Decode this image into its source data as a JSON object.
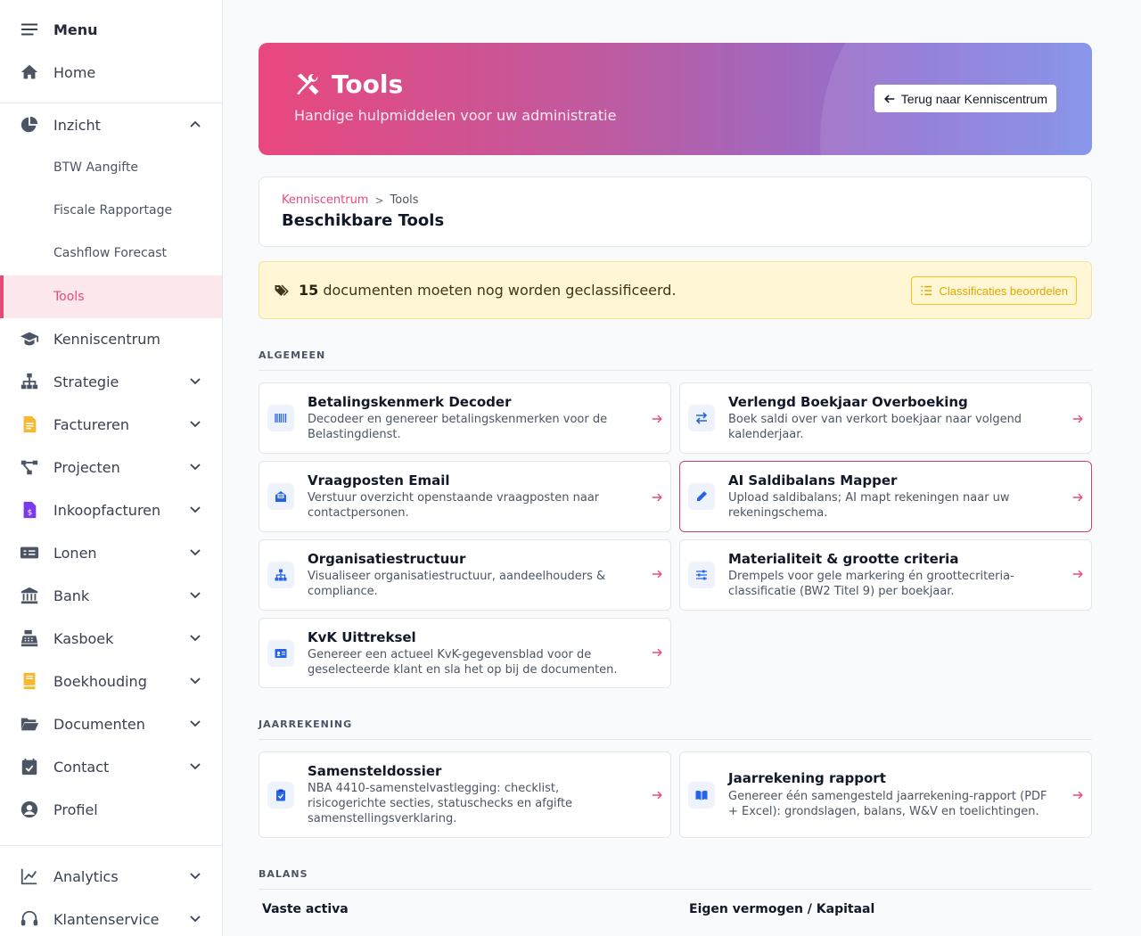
{
  "sidebar": {
    "menu_label": "Menu",
    "home_label": "Home",
    "inzicht": {
      "label": "Inzicht",
      "children": [
        "BTW Aangifte",
        "Fiscale Rapportage",
        "Cashflow Forecast",
        "Tools"
      ]
    },
    "items": [
      {
        "label": "Kenniscentrum",
        "icon": "graduation-cap-icon"
      },
      {
        "label": "Strategie",
        "icon": "sitemap-icon"
      },
      {
        "label": "Factureren",
        "icon": "file-invoice-icon"
      },
      {
        "label": "Projecten",
        "icon": "project-diagram-icon"
      },
      {
        "label": "Inkoopfacturen",
        "icon": "file-dollar-icon"
      },
      {
        "label": "Lonen",
        "icon": "money-check-icon"
      },
      {
        "label": "Bank",
        "icon": "bank-icon"
      },
      {
        "label": "Kasboek",
        "icon": "cash-register-icon"
      },
      {
        "label": "Boekhouding",
        "icon": "book-icon"
      },
      {
        "label": "Documenten",
        "icon": "folder-open-icon"
      },
      {
        "label": "Contact",
        "icon": "calendar-check-icon"
      },
      {
        "label": "Profiel",
        "icon": "user-circle-icon"
      }
    ],
    "bottom_items": [
      {
        "label": "Analytics",
        "icon": "chart-line-icon"
      },
      {
        "label": "Klantenservice",
        "icon": "headset-icon"
      }
    ]
  },
  "hero": {
    "title": "Tools",
    "subtitle": "Handige hulpmiddelen voor uw administratie",
    "back_button": "Terug naar Kenniscentrum"
  },
  "breadcrumb": {
    "link": "Kenniscentrum",
    "separator": ">",
    "current": "Tools",
    "page_title": "Beschikbare Tools"
  },
  "alert": {
    "count": "15",
    "text": " documenten moeten nog worden geclassificeerd.",
    "button": "Classificaties beoordelen"
  },
  "sections": {
    "algemeen": "ALGEMEEN",
    "jaarrekening": "JAARREKENING",
    "balans": "BALANS"
  },
  "tools_algemeen": [
    {
      "title": "Betalingskenmerk Decoder",
      "desc": "Decodeer en genereer betalingskenmerken voor de Belastingdienst.",
      "icon": "barcode-icon"
    },
    {
      "title": "Verlengd Boekjaar Overboeking",
      "desc": "Boek saldi over van verkort boekjaar naar volgend kalenderjaar.",
      "icon": "exchange-icon"
    },
    {
      "title": "Vraagposten Email",
      "desc": "Verstuur overzicht openstaande vraagposten naar contactpersonen.",
      "icon": "envelope-open-icon"
    },
    {
      "title": "AI Saldibalans Mapper",
      "desc": "Upload saldibalans; AI mapt rekeningen naar uw rekeningschema.",
      "icon": "pen-icon"
    },
    {
      "title": "Organisatiestructuur",
      "desc": "Visualiseer organisatiestructuur, aandeelhouders & compliance.",
      "icon": "sitemap-icon"
    },
    {
      "title": "Materialiteit & grootte criteria",
      "desc": "Drempels voor gele markering én groottecriteria-classificatie (BW2 Titel 9) per boekjaar.",
      "icon": "sliders-icon"
    },
    {
      "title": "KvK Uittreksel",
      "desc": "Genereer een actueel KvK-gegevensblad voor de geselecteerde klant en sla het op bij de documenten.",
      "icon": "id-card-icon"
    }
  ],
  "tools_jaarrekening": [
    {
      "title": "Samensteldossier",
      "desc": "NBA 4410-samenstelvastlegging: checklist, risicogerichte secties, statuschecks en afgifte samenstellingsverklaring.",
      "icon": "clipboard-check-icon"
    },
    {
      "title": "Jaarrekening rapport",
      "desc": "Genereer één samengesteld jaarrekening-rapport (PDF + Excel): grondslagen, balans, W&V en toelichtingen.",
      "icon": "book-open-icon"
    }
  ],
  "balans": {
    "left": "Vaste activa",
    "right": "Eigen vermogen / Kapitaal"
  },
  "colors": {
    "accent": "#e54b77",
    "icon_blue": "#2563eb",
    "alert_bg": "#fef6d4",
    "alert_button": "#e0a800"
  }
}
